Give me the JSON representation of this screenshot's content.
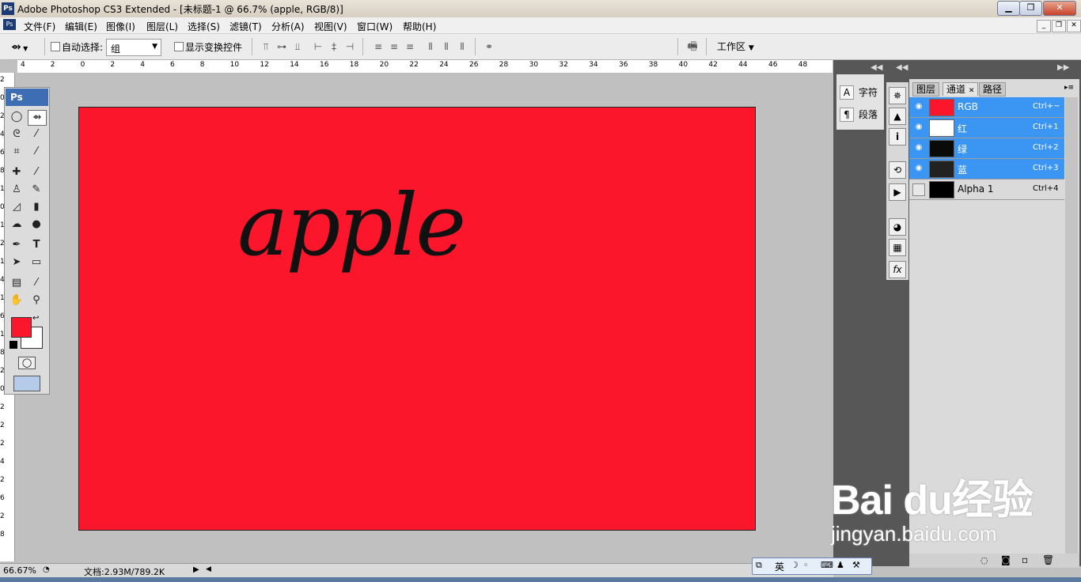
{
  "window": {
    "app_icon": "Ps",
    "title": "Adobe Photoshop CS3 Extended - [未标题-1 @ 66.7% (apple, RGB/8)]",
    "minimize_icon": "minimize-icon",
    "maximize_icon": "restore-icon",
    "close_icon": "close-icon"
  },
  "menu": {
    "items": [
      "文件(F)",
      "编辑(E)",
      "图像(I)",
      "图层(L)",
      "选择(S)",
      "滤镜(T)",
      "分析(A)",
      "视图(V)",
      "窗口(W)",
      "帮助(H)"
    ]
  },
  "options": {
    "auto_select_label": "自动选择:",
    "auto_select_value": "组",
    "show_transform_label": "显示变换控件",
    "workspace_label": "工作区"
  },
  "rulers": {
    "top_ticks": [
      "4",
      "2",
      "0",
      "2",
      "4",
      "6",
      "8",
      "10",
      "12",
      "14",
      "16",
      "18",
      "20",
      "22",
      "24",
      "26",
      "28",
      "30",
      "32",
      "34",
      "36",
      "38",
      "40",
      "42",
      "44",
      "46",
      "48"
    ],
    "left_ticks": [
      "2",
      "0",
      "2",
      "4",
      "6",
      "8",
      "1",
      "0",
      "1",
      "2",
      "1",
      "4",
      "1",
      "6",
      "1",
      "8",
      "2",
      "0",
      "2",
      "2",
      "2",
      "4",
      "2",
      "6",
      "2",
      "8"
    ]
  },
  "document": {
    "text": "apple",
    "background_color": "#fc162c",
    "text_color": "#111111"
  },
  "toolbox": {
    "header": "Ps",
    "foreground_color": "#fc162c",
    "background_color": "#ffffff"
  },
  "mini_panel": {
    "character": "字符",
    "paragraph": "段落"
  },
  "channels_panel": {
    "tabs": [
      "图层",
      "通道",
      "路径"
    ],
    "active_tab": "通道",
    "channels": [
      {
        "name": "RGB",
        "shortcut": "Ctrl+~",
        "visible": true,
        "selected": true,
        "thumb_color": "#fc162c"
      },
      {
        "name": "红",
        "shortcut": "Ctrl+1",
        "visible": true,
        "selected": true,
        "thumb_color": "#ffffff"
      },
      {
        "name": "绿",
        "shortcut": "Ctrl+2",
        "visible": true,
        "selected": true,
        "thumb_color": "#0a0a0a"
      },
      {
        "name": "蓝",
        "shortcut": "Ctrl+3",
        "visible": true,
        "selected": true,
        "thumb_color": "#222222"
      },
      {
        "name": "Alpha 1",
        "shortcut": "Ctrl+4",
        "visible": false,
        "selected": false,
        "thumb_color": "#000000"
      }
    ]
  },
  "status": {
    "zoom": "66.67%",
    "doc_info": "文档:2.93M/789.2K"
  },
  "ime": {
    "lang": "英"
  },
  "watermark": {
    "brand": "Bai du经验",
    "domain": "jingyan.baidu.com"
  }
}
